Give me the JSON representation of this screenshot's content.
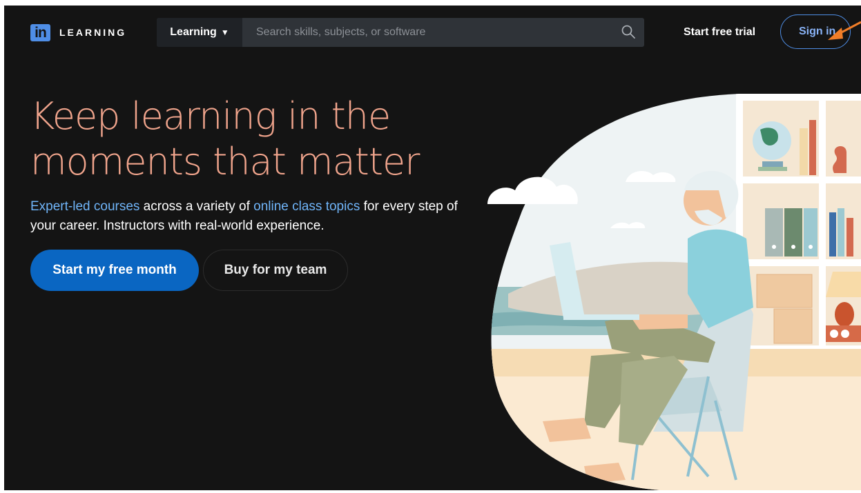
{
  "header": {
    "logo_mark": "in",
    "logo_text": "LEARNING",
    "search": {
      "category_label": "Learning",
      "placeholder": "Search skills, subjects, or software"
    },
    "start_trial_label": "Start free trial",
    "sign_in_label": "Sign in"
  },
  "hero": {
    "headline": "Keep learning in the moments that matter",
    "subline": {
      "link1": "Expert-led courses",
      "text1": " across a variety of ",
      "link2": "online class topics",
      "text2": " for every step of your career. Instructors with real-world experience."
    },
    "primary_cta": "Start my free month",
    "secondary_cta": "Buy for my team"
  },
  "icons": {
    "search": "search-icon",
    "caret": "caret-down-icon",
    "arrow": "arrow-annotation-icon"
  },
  "colors": {
    "background": "#141414",
    "accent_blue": "#0a66c2",
    "link_blue": "#70b5f9",
    "headline": "#f0a48c",
    "annotation_arrow": "#f07d28"
  }
}
